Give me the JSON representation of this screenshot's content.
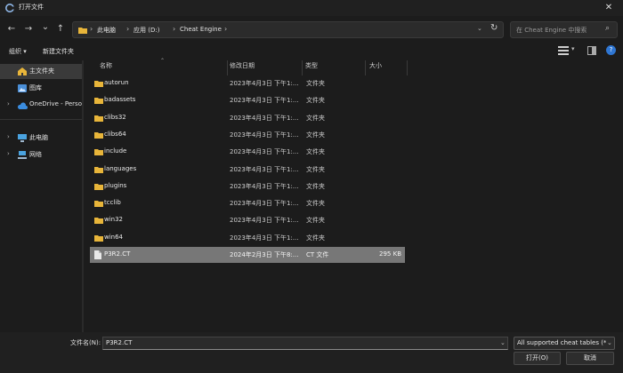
{
  "titlebar": {
    "title": "打开文件",
    "close": "✕"
  },
  "nav": {
    "back": "←",
    "forward": "→",
    "recent": "⌄",
    "up": "↑",
    "breadcrumbs": [
      "此电脑",
      "应用 (D:)",
      "Cheat Engine"
    ],
    "separator": "›",
    "address_dropdown": "⌄",
    "refresh": "↻",
    "search_placeholder": "在 Cheat Engine 中搜索",
    "search_icon": "⌕"
  },
  "toolbar": {
    "organize": "组织 ▾",
    "new_folder": "新建文件夹",
    "view_dropdown": "▾",
    "help": "?"
  },
  "sidebar": {
    "items": [
      {
        "label": "主文件夹",
        "icon": "home-icon",
        "selected": true
      },
      {
        "label": "图库",
        "icon": "gallery-icon"
      },
      {
        "label": "OneDrive - Personal",
        "icon": "cloud-icon",
        "chevron": "›"
      },
      {
        "label": "此电脑",
        "icon": "computer-icon",
        "chevron": "›"
      },
      {
        "label": "网络",
        "icon": "network-icon",
        "chevron": "›"
      }
    ]
  },
  "columns": {
    "name": "名称",
    "modified": "修改日期",
    "type": "类型",
    "size": "大小"
  },
  "files": [
    {
      "name": "autorun",
      "modified": "2023年4月3日 下午1:...",
      "type": "文件夹",
      "size": "",
      "kind": "folder"
    },
    {
      "name": "badassets",
      "modified": "2023年4月3日 下午1:...",
      "type": "文件夹",
      "size": "",
      "kind": "folder"
    },
    {
      "name": "clibs32",
      "modified": "2023年4月3日 下午1:...",
      "type": "文件夹",
      "size": "",
      "kind": "folder"
    },
    {
      "name": "clibs64",
      "modified": "2023年4月3日 下午1:...",
      "type": "文件夹",
      "size": "",
      "kind": "folder"
    },
    {
      "name": "include",
      "modified": "2023年4月3日 下午1:...",
      "type": "文件夹",
      "size": "",
      "kind": "folder"
    },
    {
      "name": "languages",
      "modified": "2023年4月3日 下午1:...",
      "type": "文件夹",
      "size": "",
      "kind": "folder"
    },
    {
      "name": "plugins",
      "modified": "2023年4月3日 下午1:...",
      "type": "文件夹",
      "size": "",
      "kind": "folder"
    },
    {
      "name": "tcclib",
      "modified": "2023年4月3日 下午1:...",
      "type": "文件夹",
      "size": "",
      "kind": "folder"
    },
    {
      "name": "win32",
      "modified": "2023年4月3日 下午1:...",
      "type": "文件夹",
      "size": "",
      "kind": "folder"
    },
    {
      "name": "win64",
      "modified": "2023年4月3日 下午1:...",
      "type": "文件夹",
      "size": "",
      "kind": "folder"
    },
    {
      "name": "P3R2.CT",
      "modified": "2024年2月3日 下午8:...",
      "type": "CT 文件",
      "size": "295 KB",
      "kind": "file",
      "selected": true
    }
  ],
  "bottom": {
    "filename_label": "文件名(N):",
    "filename_value": "P3R2.CT",
    "filter_value": "All supported cheat tables (*",
    "dropdown": "⌄",
    "open_button": "打开(O)",
    "cancel_button": "取消"
  },
  "colors": {
    "background": "#1c1c1c",
    "selected_row": "#777777",
    "folder": "#e8b53a",
    "accent": "#2f76d2"
  }
}
